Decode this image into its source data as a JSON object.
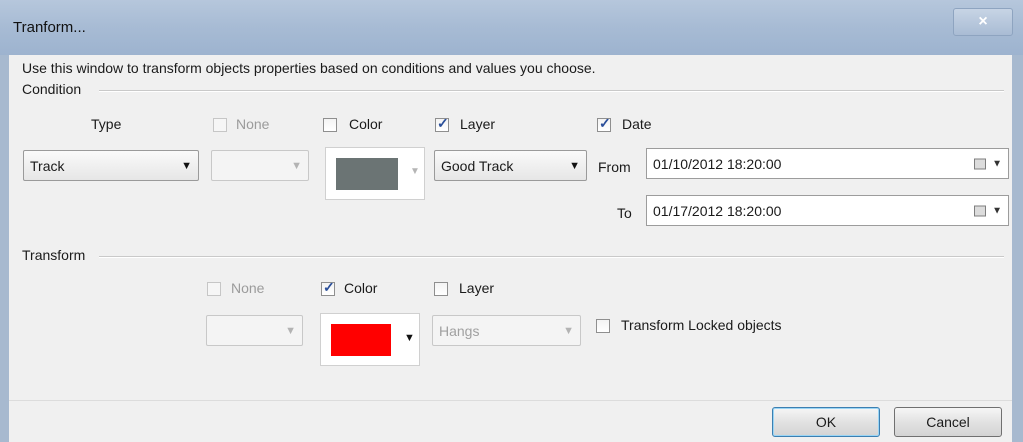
{
  "window": {
    "title": "Tranform...",
    "close_label": "×",
    "description": "Use this window to transform objects properties based on conditions and values you choose."
  },
  "condition": {
    "group_label": "Condition",
    "type_label": "Type",
    "type_value": "Track",
    "none_label": "None",
    "none_checked": false,
    "none_value": "",
    "color_label": "Color",
    "color_checked": false,
    "color_value": "#6b7474",
    "layer_label": "Layer",
    "layer_checked": true,
    "layer_value": "Good Track",
    "date_label": "Date",
    "date_checked": true,
    "from_label": "From",
    "from_value": "01/10/2012 18:20:00",
    "to_label": "To",
    "to_value": "01/17/2012 18:20:00"
  },
  "transform": {
    "group_label": "Transform",
    "none_label": "None",
    "none_checked": false,
    "none_value": "",
    "color_label": "Color",
    "color_checked": true,
    "color_value": "#ff0000",
    "layer_label": "Layer",
    "layer_checked": false,
    "layer_value": "Hangs",
    "locked_label": "Transform Locked objects",
    "locked_checked": false
  },
  "buttons": {
    "ok": "OK",
    "cancel": "Cancel"
  },
  "icons": {
    "dropdown": "▼",
    "calendar": "calendar-icon"
  }
}
